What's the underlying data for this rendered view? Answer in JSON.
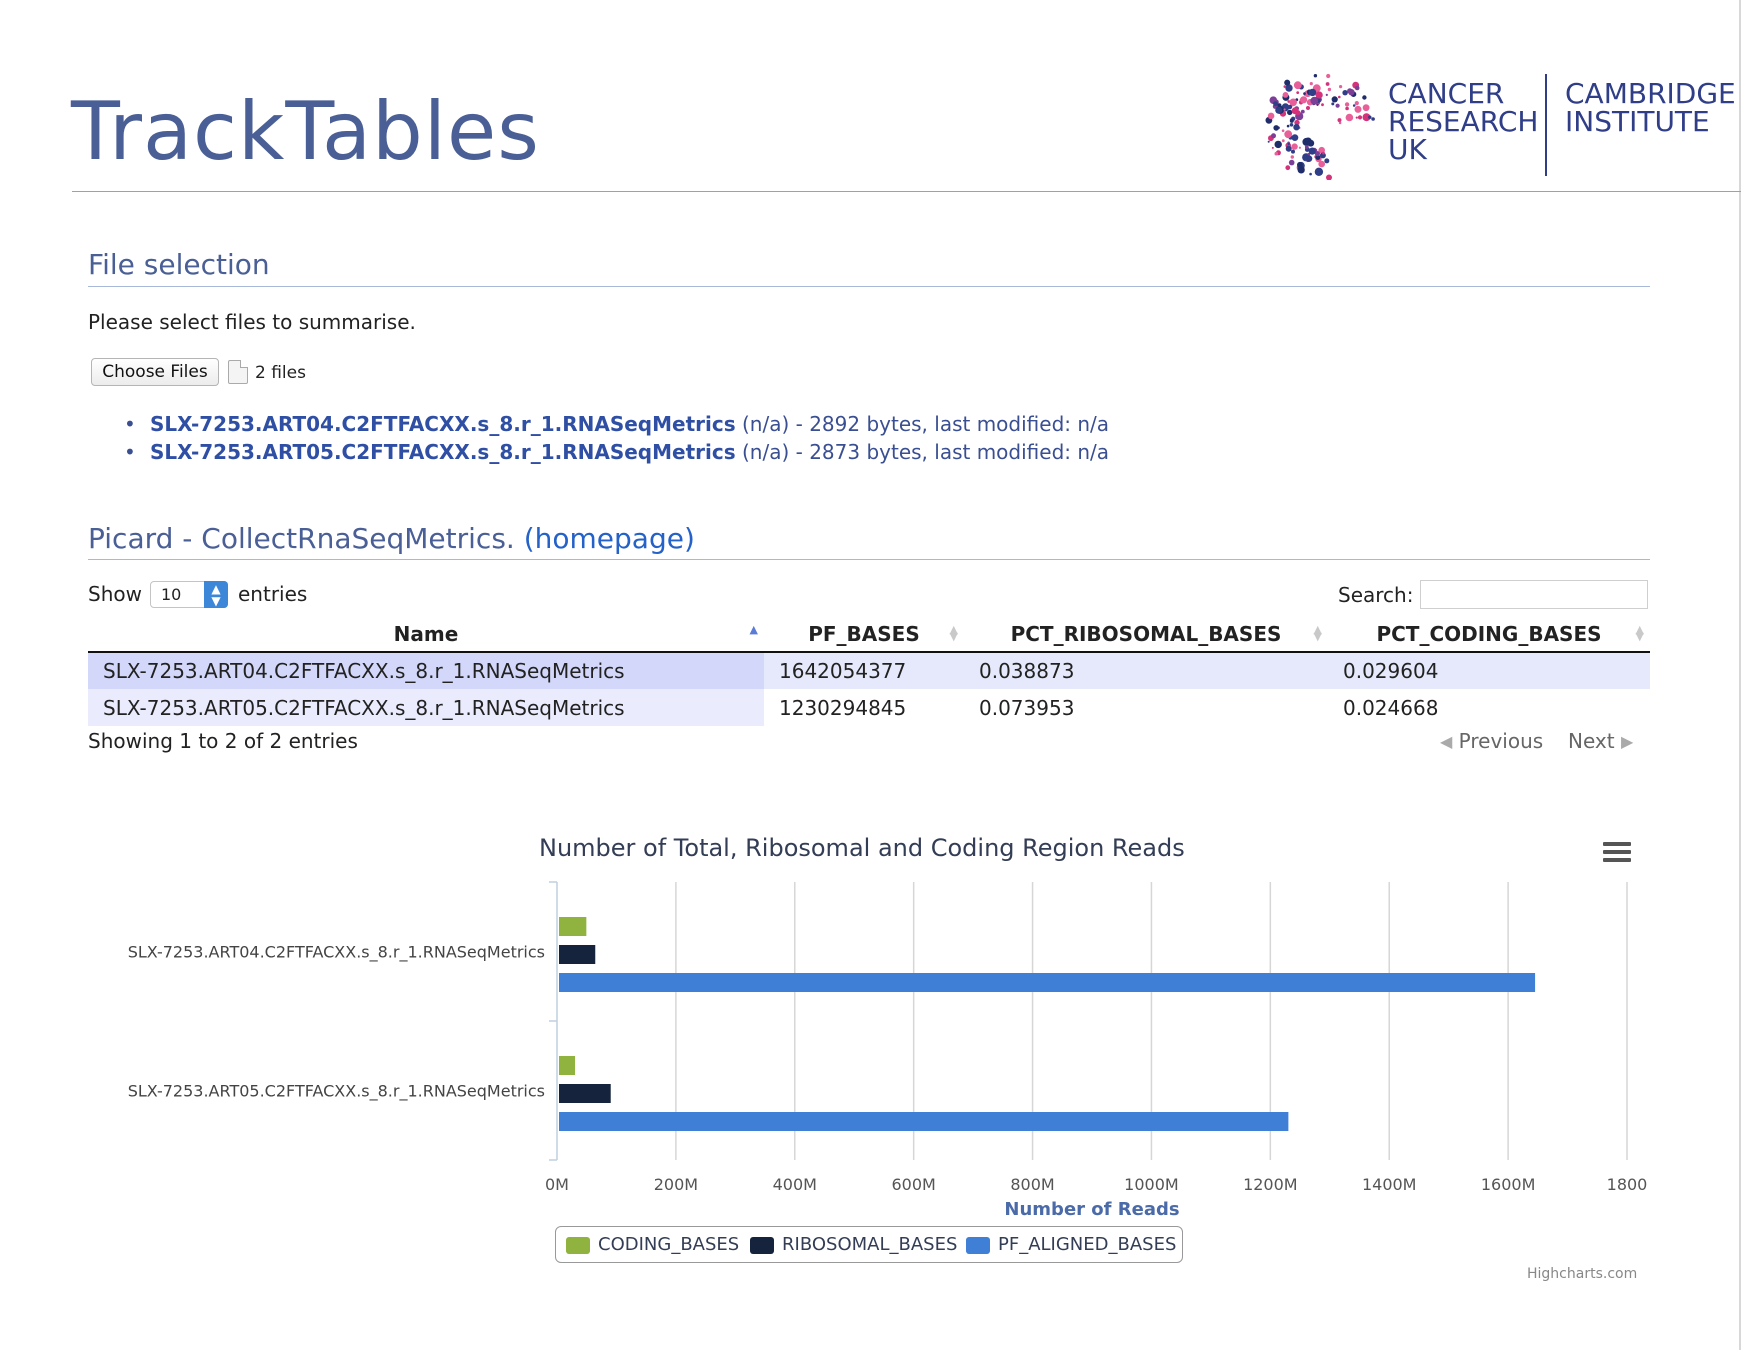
{
  "app": {
    "title": "TrackTables"
  },
  "logo": {
    "cru": [
      "CANCER",
      "RESEARCH",
      "UK"
    ],
    "cam": [
      "CAMBRIDGE",
      "INSTITUTE"
    ]
  },
  "file_selection": {
    "heading": "File selection",
    "intro": "Please select files to summarise.",
    "choose_button": "Choose Files",
    "files_count": "2 files",
    "files": [
      {
        "name": "SLX-7253.ART04.C2FTFACXX.s_8.r_1.RNASeqMetrics",
        "details": " (n/a) - 2892 bytes, last modified: n/a"
      },
      {
        "name": "SLX-7253.ART05.C2FTFACXX.s_8.r_1.RNASeqMetrics",
        "details": " (n/a) - 2873 bytes, last modified: n/a"
      }
    ]
  },
  "picard": {
    "heading": "Picard - CollectRnaSeqMetrics.",
    "homepage_link": "(homepage)",
    "show_label": "Show",
    "entries_value": "10",
    "entries_label": "entries",
    "search_label": "Search:",
    "search_value": "",
    "columns": [
      "Name",
      "PF_BASES",
      "PCT_RIBOSOMAL_BASES",
      "PCT_CODING_BASES"
    ],
    "rows": [
      [
        "SLX-7253.ART04.C2FTFACXX.s_8.r_1.RNASeqMetrics",
        "1642054377",
        "0.038873",
        "0.029604"
      ],
      [
        "SLX-7253.ART05.C2FTFACXX.s_8.r_1.RNASeqMetrics",
        "1230294845",
        "0.073953",
        "0.024668"
      ]
    ],
    "info": "Showing 1 to 2 of 2 entries",
    "prev_label": "Previous",
    "next_label": "Next"
  },
  "chart_data": {
    "type": "bar",
    "orientation": "horizontal",
    "title": "Number of Total, Ribosomal and Coding Region Reads",
    "xlabel": "Number of Reads",
    "ylabel": "",
    "categories": [
      "SLX-7253.ART04.C2FTFACXX.s_8.r_1.RNASeqMetrics",
      "SLX-7253.ART05.C2FTFACXX.s_8.r_1.RNASeqMetrics"
    ],
    "series": [
      {
        "name": "CODING_BASES",
        "color": "#90b23f",
        "values": [
          46000000,
          27000000
        ]
      },
      {
        "name": "RIBOSOMAL_BASES",
        "color": "#15233d",
        "values": [
          61000000,
          87000000
        ]
      },
      {
        "name": "PF_ALIGNED_BASES",
        "color": "#3f7fd6",
        "values": [
          1642000000,
          1227000000
        ]
      }
    ],
    "xlim": [
      0,
      1800000000
    ],
    "ticks": [
      "0M",
      "200M",
      "400M",
      "600M",
      "800M",
      "1000M",
      "1200M",
      "1400M",
      "1600M",
      "1800"
    ],
    "grid": true,
    "legend_position": "bottom",
    "credits": "Highcharts.com"
  },
  "colors": {
    "accent": "#4a5f96",
    "link": "#2f4fa5"
  }
}
